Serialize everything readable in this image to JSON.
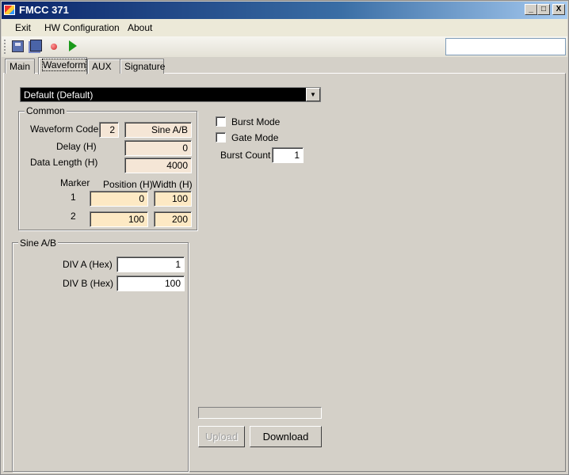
{
  "window": {
    "title": "FMCC 371",
    "min": "_",
    "max": "□",
    "close": "X"
  },
  "menu": [
    "Exit",
    "HW Configuration",
    "About"
  ],
  "toolbar": {
    "icons": [
      "save-icon",
      "save-all-icon",
      "record-icon",
      "play-icon"
    ],
    "search_value": ""
  },
  "tabs": [
    "Main",
    "Waveform",
    "AUX",
    "Signature"
  ],
  "active_tab": "Waveform",
  "preset": {
    "selected": "Default (Default)",
    "arrow": "▼"
  },
  "common": {
    "title": "Common",
    "waveform_code_label": "Waveform Code",
    "waveform_code": "2",
    "waveform_name": "Sine A/B",
    "delay_label": "Delay (H)",
    "delay": "0",
    "data_length_label": "Data Length (H)",
    "data_length": "4000",
    "marker_label": "Marker",
    "position_label": "Position (H)",
    "width_label": "Width (H)",
    "markers": [
      {
        "id": "1",
        "position": "0",
        "width": "100"
      },
      {
        "id": "2",
        "position": "100",
        "width": "200"
      }
    ]
  },
  "burst": {
    "burst_mode_label": "Burst Mode",
    "burst_mode": false,
    "gate_mode_label": "Gate Mode",
    "gate_mode": false,
    "burst_count_label": "Burst Count",
    "burst_count": "1"
  },
  "sine": {
    "title": "Sine A/B",
    "div_a_label": "DIV A (Hex)",
    "div_a": "1",
    "div_b_label": "DIV B (Hex)",
    "div_b": "100"
  },
  "actions": {
    "progress": 0,
    "upload": "Upload",
    "download": "Download"
  }
}
